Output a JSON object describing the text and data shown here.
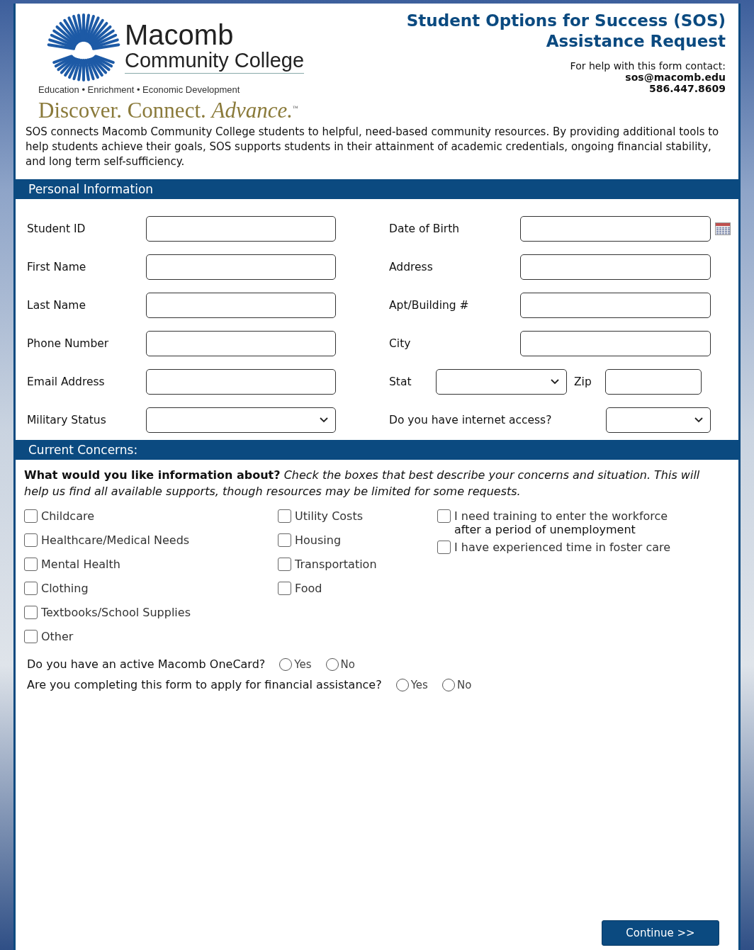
{
  "header": {
    "logo": {
      "name": "Macomb",
      "subname": "Community College",
      "tagline": "Education • Enrichment • Economic Development",
      "slogan": "Discover. Connect. *Advance.*$^{™}$"
    },
    "title": [
      "Student Options for Success (SOS)",
      "Assistance Request"
    ],
    "contact": {
      "label": "For help with this form contact:",
      "email": "sos@macomb.edu",
      "phone": "586.447.8609"
    },
    "intro": "SOS connects Macomb Community College students to helpful, need-based community resources. By providing additional tools to help students achieve their goals, SOS supports students in their attainment of academic credentials, ongoing financial stability, and long term self-sufficiency."
  },
  "personal": {
    "title": "Personal Information",
    "rows": [
      {
        "left": {
          "label": "Student ID",
          "kind": "text"
        },
        "right": [
          {
            "label": "Date of Birth",
            "kind": "date"
          }
        ]
      },
      {
        "left": {
          "label": "First Name",
          "kind": "text"
        },
        "right": [
          {
            "label": "Address",
            "kind": "text"
          }
        ]
      },
      {
        "left": {
          "label": "Last Name",
          "kind": "text"
        },
        "right": [
          {
            "label": "Apt/Building #",
            "kind": "text"
          }
        ]
      },
      {
        "left": {
          "label": "Phone Number",
          "kind": "text"
        },
        "right": [
          {
            "label": "City",
            "kind": "text"
          }
        ]
      },
      {
        "left": {
          "label": "Email Address",
          "kind": "text"
        },
        "right": [
          {
            "label": "Stat",
            "kind": "select"
          },
          {
            "label": "Zip",
            "kind": "text"
          }
        ]
      },
      {
        "left": {
          "label": "Military Status",
          "kind": "select"
        },
        "right": [
          {
            "label": "Do you have internet access?",
            "kind": "select"
          }
        ]
      }
    ]
  },
  "concerns": {
    "title": "Current Concerns:",
    "prompt": "**What would you like information about?** *Check the boxes that best describe your concerns and situation. This will help us find all available supports, though resources may be limited for some requests.*",
    "columns": [
      [
        {
          "label": "Childcare",
          "checked": false
        },
        {
          "label": "Healthcare/Medical Needs",
          "checked": false
        },
        {
          "label": "Mental Health",
          "checked": false
        },
        {
          "label": "Clothing",
          "checked": false
        },
        {
          "label": "Textbooks/School Supplies",
          "checked": false
        },
        {
          "label": "Other",
          "checked": false
        }
      ],
      [
        {
          "label": "Utility Costs",
          "checked": false
        },
        {
          "label": "Housing",
          "checked": false
        },
        {
          "label": "Transportation",
          "checked": false
        },
        {
          "label": "Food",
          "checked": false
        }
      ],
      [
        {
          "label": "I need training to enter the workforce",
          "label_2": "after a period of unemployment",
          "checked": false
        },
        {
          "label": "I have experienced time in foster care",
          "checked": false
        }
      ]
    ],
    "questions": [
      {
        "text": "Do you have an active Macomb OneCard?",
        "options": [
          {
            "label": "Yes",
            "selected": false
          },
          {
            "label": "No",
            "selected": false
          }
        ]
      },
      {
        "text": "Are you completing this form to apply for financial assistance?",
        "options": [
          {
            "label": "Yes",
            "selected": false
          },
          {
            "label": "No",
            "selected": false
          }
        ]
      }
    ]
  },
  "continue_button": "Continue >>"
}
